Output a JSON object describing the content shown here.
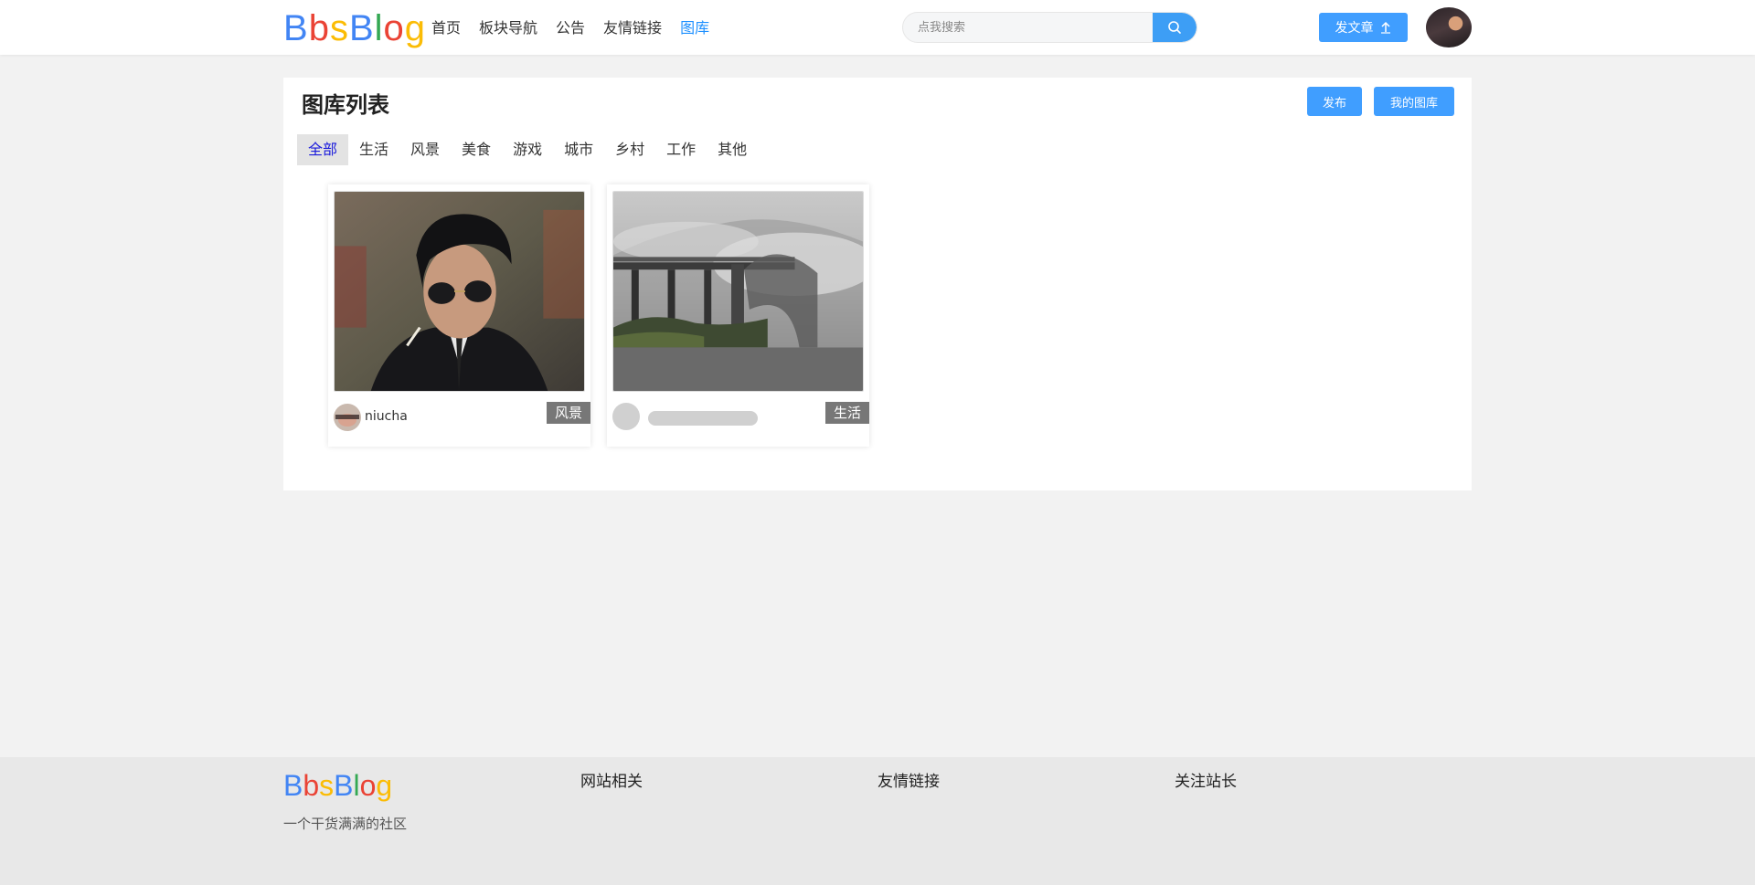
{
  "header": {
    "logo_letters": [
      "B",
      "b",
      "s",
      "B",
      "l",
      "o",
      "g"
    ],
    "nav": [
      "首页",
      "板块导航",
      "公告",
      "友情链接",
      "图库"
    ],
    "active_nav": "图库",
    "search_placeholder": "点我搜索",
    "post_button": "发文章"
  },
  "main": {
    "title": "图库列表",
    "publish_button": "发布",
    "my_gallery_button": "我的图库",
    "tabs": [
      "全部",
      "生活",
      "风景",
      "美食",
      "游戏",
      "城市",
      "乡村",
      "工作",
      "其他"
    ],
    "active_tab": "全部",
    "cards": [
      {
        "user": "niucha",
        "tag": "风景"
      },
      {
        "user": "",
        "tag": "生活"
      }
    ]
  },
  "footer": {
    "logo": "BbsBlog",
    "slogan": "一个干货满满的社区",
    "columns": [
      "网站相关",
      "友情链接",
      "关注站长"
    ]
  },
  "colors": {
    "accent": "#409eff",
    "active_nav": "#1e90ff",
    "active_tab_text": "#1a1adb",
    "tag_bg": "#777777",
    "logo": [
      "#4285f4",
      "#ea4335",
      "#fbbc05",
      "#4285f4",
      "#34a853",
      "#ea4335",
      "#fbbc05"
    ]
  }
}
